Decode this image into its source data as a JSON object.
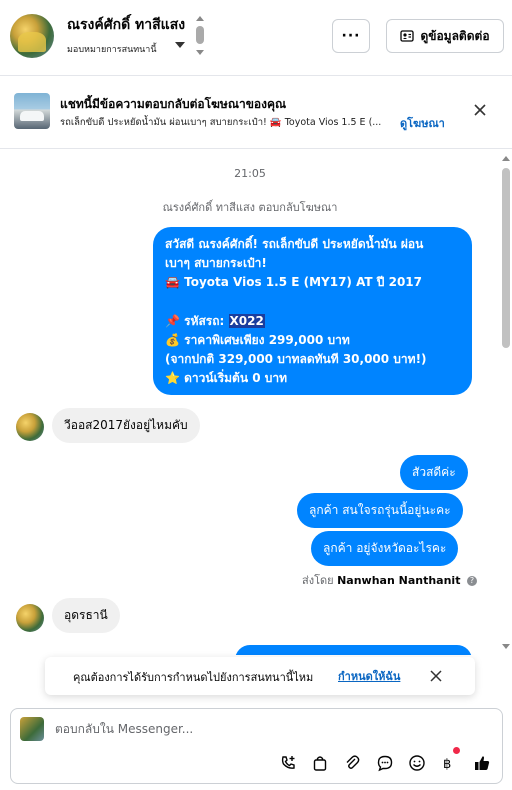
{
  "header": {
    "name": "ณรงค์ศักดิ์ ทาสีแสง",
    "assign_label": "มอบหมายการสนทนานี้",
    "more_label": "···",
    "contact_label": "ดูข้อมูลติดต่อ"
  },
  "ad_banner": {
    "title": "แชทนี้มีข้อความตอบกลับต่อโฆษณาของคุณ",
    "description": "รถเล็กขับดี ประหยัดน้ำมัน ผ่อนเบาๆ สบายกระเป๋า! 🚘 Toyota Vios 1.5 E (...",
    "link": "ดูโฆษณา"
  },
  "chat": {
    "timestamp": "21:05",
    "reply_note": "ณรงค์ศักดิ์ ทาสีแสง ตอบกลับโฆษณา",
    "ad_message": {
      "line1": "สวัสดี ณรงค์ศักดิ์! รถเล็กขับดี ประหยัดน้ำมัน ผ่อน",
      "line2": "เบาๆ สบายกระเป๋า!",
      "line3": "🚘 Toyota Vios 1.5 E (MY17) AT ปี 2017",
      "line4_prefix": "📌 รหัสรถ: ",
      "line4_code": "X022",
      "line5": "💰 ราคาพิเศษเพียง 299,000 บาท",
      "line6": "(จากปกติ 329,000 บาทลดทันที 30,000 บาท!)",
      "line7": "⭐ ดาวน์เริ่มต้น 0 บาท"
    },
    "incoming_1": "วีออส2017ยังอยู่ไหมคับ",
    "outgoing_1": "สัวสดีค่ะ",
    "outgoing_2": "ลูกค้า สนใจรถรุ่นนี้อยู่นะคะ",
    "outgoing_3": "ลูกค้า อยู่จังหวัดอะไรคะ",
    "sent_by_prefix": "ส่งโดย",
    "sent_by_name": "Nanwhan Nanthanit",
    "incoming_2": "อุดรธานี"
  },
  "assign_prompt": {
    "text": "คุณต้องการได้รับการกำหนดไปยังการสนทนานี้ไหม",
    "link": "กำหนดให้ฉัน"
  },
  "composer": {
    "placeholder": "ตอบกลับใน Messenger..."
  },
  "colors": {
    "accent": "#0084ff",
    "link": "#0a66c2",
    "notification_dot": "#f02849"
  },
  "icons": [
    "ellipsis-icon",
    "contact-card-icon",
    "close-icon",
    "phone-plus-icon",
    "shopping-bag-icon",
    "paperclip-icon",
    "chat-bubble-icon",
    "emoji-icon",
    "baht-icon",
    "thumbs-up-icon",
    "info-icon",
    "chevron-down-icon"
  ]
}
